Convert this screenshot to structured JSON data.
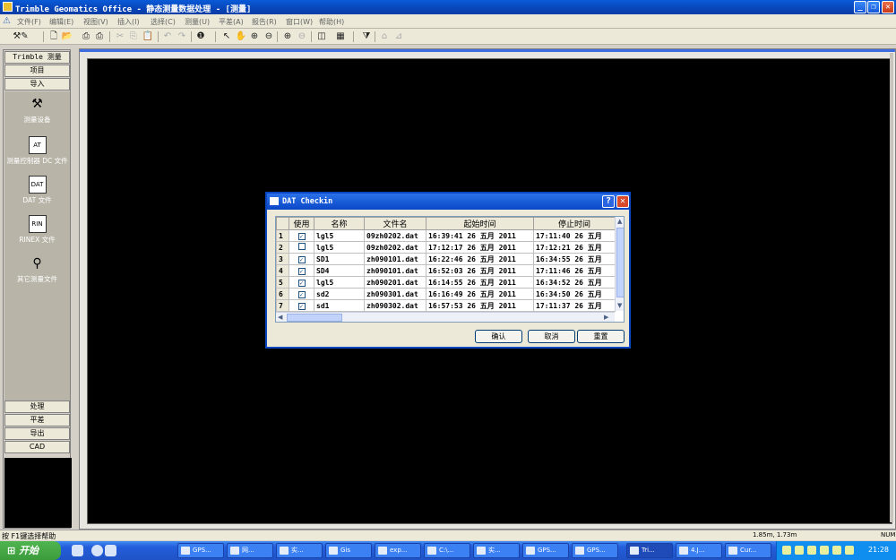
{
  "window": {
    "title": "Trimble Geomatics Office - 静态测量数据处理 - [测量]"
  },
  "menu": [
    "文件(F)",
    "编辑(E)",
    "视图(V)",
    "插入(I)",
    "选择(C)",
    "测量(U)",
    "平差(A)",
    "报告(R)",
    "窗口(W)",
    "帮助(H)"
  ],
  "toolbar": {
    "icons": [
      "survey-icon",
      "new-icon",
      "open-icon",
      "print-icon",
      "print-preview-icon",
      "cut-icon",
      "copy-icon",
      "paste-icon",
      "undo-icon",
      "redo-icon",
      "info-icon",
      "pointer-icon",
      "pan-icon",
      "zoom-in-icon",
      "zoom-out-icon",
      "zoom-extents-icon",
      "zoom-window-icon",
      "layout-icon",
      "grid-icon",
      "filter-icon",
      "network-icon",
      "loop-icon"
    ]
  },
  "sidebar": {
    "title": "Trimble 测量",
    "project": "项目",
    "import": "导入",
    "items": [
      {
        "label": "测量设备",
        "icon": "survey-device-icon"
      },
      {
        "label": "测量控制器 DC 文件",
        "icon": "dc-file-icon",
        "glyph": "AT"
      },
      {
        "label": "DAT 文件",
        "icon": "dat-file-icon",
        "glyph": "DAT"
      },
      {
        "label": "RINEX 文件",
        "icon": "rinex-file-icon",
        "glyph": "RIN"
      },
      {
        "label": "其它测量文件",
        "icon": "other-survey-file-icon"
      }
    ],
    "process": "处理",
    "adjust": "平差",
    "export": "导出",
    "cad": "CAD"
  },
  "dialog": {
    "title": "DAT Checkin",
    "help": "?",
    "close": "✕",
    "columns": [
      "使用",
      "名称",
      "文件名",
      "起始时间",
      "停止时间"
    ],
    "rows": [
      {
        "n": "1",
        "use": true,
        "name": "lgl5",
        "file": "09zh0202.dat",
        "start": "16:39:41 26 五月 2011",
        "stop": "17:11:40 26 五月"
      },
      {
        "n": "2",
        "use": false,
        "name": "lgl5",
        "file": "09zh0202.dat",
        "start": "17:12:17 26 五月 2011",
        "stop": "17:12:21 26 五月"
      },
      {
        "n": "3",
        "use": true,
        "name": "SD1",
        "file": "zh090101.dat",
        "start": "16:22:46 26 五月 2011",
        "stop": "16:34:55 26 五月"
      },
      {
        "n": "4",
        "use": true,
        "name": "SD4",
        "file": "zh090101.dat",
        "start": "16:52:03 26 五月 2011",
        "stop": "17:11:46 26 五月"
      },
      {
        "n": "5",
        "use": true,
        "name": "lgl5",
        "file": "zh090201.dat",
        "start": "16:14:55 26 五月 2011",
        "stop": "16:34:52 26 五月"
      },
      {
        "n": "6",
        "use": true,
        "name": "sd2",
        "file": "zh090301.dat",
        "start": "16:16:49 26 五月 2011",
        "stop": "16:34:50 26 五月"
      },
      {
        "n": "7",
        "use": true,
        "name": "sd1",
        "file": "zh090302.dat",
        "start": "16:57:53 26 五月 2011",
        "stop": "17:11:37 26 五月"
      }
    ],
    "buttons": {
      "ok": "确认",
      "cancel": "取消",
      "reset": "重置"
    }
  },
  "status": {
    "help": "按 F1键选择帮助",
    "coords": "1.85m, 1.73m",
    "mode": "NUM"
  },
  "taskbar": {
    "start": "开始",
    "tasks": [
      "GPS...",
      "网...",
      "实...",
      "Gis",
      "exp...",
      "C:\\...",
      "实...",
      "GPS...",
      "GPS...",
      "Tri...",
      "4.J...",
      "Cur..."
    ],
    "active_index": 9,
    "clock": "21:28"
  }
}
